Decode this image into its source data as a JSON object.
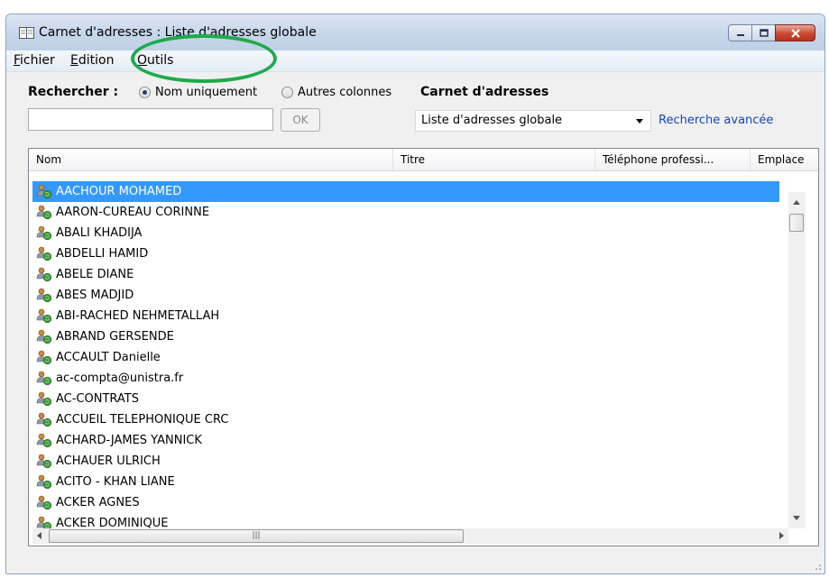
{
  "window": {
    "title": "Carnet d'adresses : Liste d'adresses globale"
  },
  "menu": {
    "file": "Fichier",
    "edit": "Edition",
    "tools": "Outils"
  },
  "search": {
    "label": "Rechercher :",
    "option_name_only": "Nom uniquement",
    "option_other_columns": "Autres colonnes",
    "selected_option": "Nom uniquement",
    "input_value": "",
    "ok_label": "OK"
  },
  "address_book": {
    "label": "Carnet d'adresses",
    "selected": "Liste d'adresses globale",
    "advanced_search": "Recherche avancée"
  },
  "table": {
    "columns": [
      "Nom",
      "Titre",
      "Téléphone professi...",
      "Emplace"
    ],
    "rows": [
      {
        "name": "AACHOUR MOHAMED",
        "selected": true
      },
      {
        "name": "AARON-CUREAU CORINNE"
      },
      {
        "name": "ABALI KHADIJA"
      },
      {
        "name": "ABDELLI HAMID"
      },
      {
        "name": "ABELE DIANE"
      },
      {
        "name": "ABES MADJID"
      },
      {
        "name": "ABI-RACHED NEHMETALLAH"
      },
      {
        "name": "ABRAND GERSENDE"
      },
      {
        "name": "ACCAULT Danielle"
      },
      {
        "name": "ac-compta@unistra.fr"
      },
      {
        "name": "AC-CONTRATS"
      },
      {
        "name": "ACCUEIL TELEPHONIQUE CRC"
      },
      {
        "name": "ACHARD-JAMES YANNICK"
      },
      {
        "name": "ACHAUER ULRICH"
      },
      {
        "name": "ACITO - KHAN LIANE"
      },
      {
        "name": "ACKER AGNES"
      },
      {
        "name": "ACKER DOMINIQUE"
      }
    ]
  },
  "icons": {
    "title": "address-book-icon",
    "contact": "contact-icon"
  },
  "colors": {
    "selection": "#3399ff",
    "link": "#1247b8",
    "highlight_ellipse": "#1faa4c",
    "close_button": "#c9492f"
  }
}
